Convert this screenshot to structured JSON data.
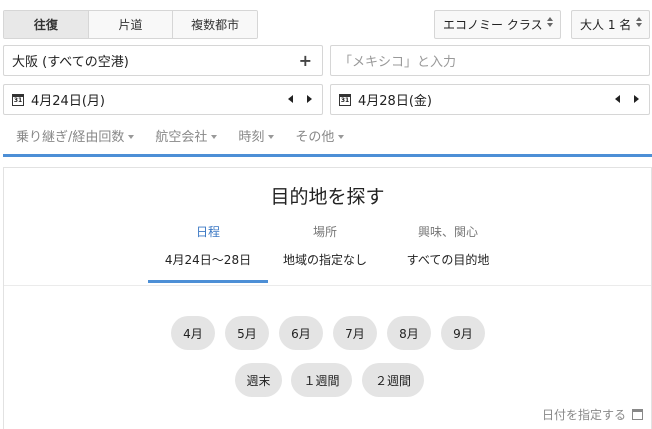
{
  "trip_types": [
    {
      "label": "往復",
      "active": true
    },
    {
      "label": "片道",
      "active": false
    },
    {
      "label": "複数都市",
      "active": false
    }
  ],
  "cabin_class": "エコノミー クラス",
  "passengers": "大人 1 名",
  "origin": {
    "value": "大阪 (すべての空港)"
  },
  "destination": {
    "placeholder": "「メキシコ」と入力"
  },
  "departure_date": {
    "value": "4月24日(月)",
    "icon_text": "31"
  },
  "return_date": {
    "value": "4月28日(金)",
    "icon_text": "31"
  },
  "filters": [
    "乗り継ぎ/経由回数",
    "航空会社",
    "時刻",
    "その他"
  ],
  "explore": {
    "title": "目的地を探す",
    "columns": [
      {
        "header": "日程",
        "value": "4月24日〜28日",
        "active": true
      },
      {
        "header": "場所",
        "value": "地域の指定なし",
        "active": false
      },
      {
        "header": "興味、関心",
        "value": "すべての目的地",
        "active": false
      }
    ],
    "months": [
      "4月",
      "5月",
      "6月",
      "7月",
      "8月",
      "9月"
    ],
    "durations": [
      "週末",
      "１週間",
      "２週間"
    ],
    "specify_date_label": "日付を指定する"
  },
  "colors": {
    "accent": "#4d8fd6",
    "active_tab_text": "#3b78c4",
    "chip_bg": "#e4e4e4"
  }
}
